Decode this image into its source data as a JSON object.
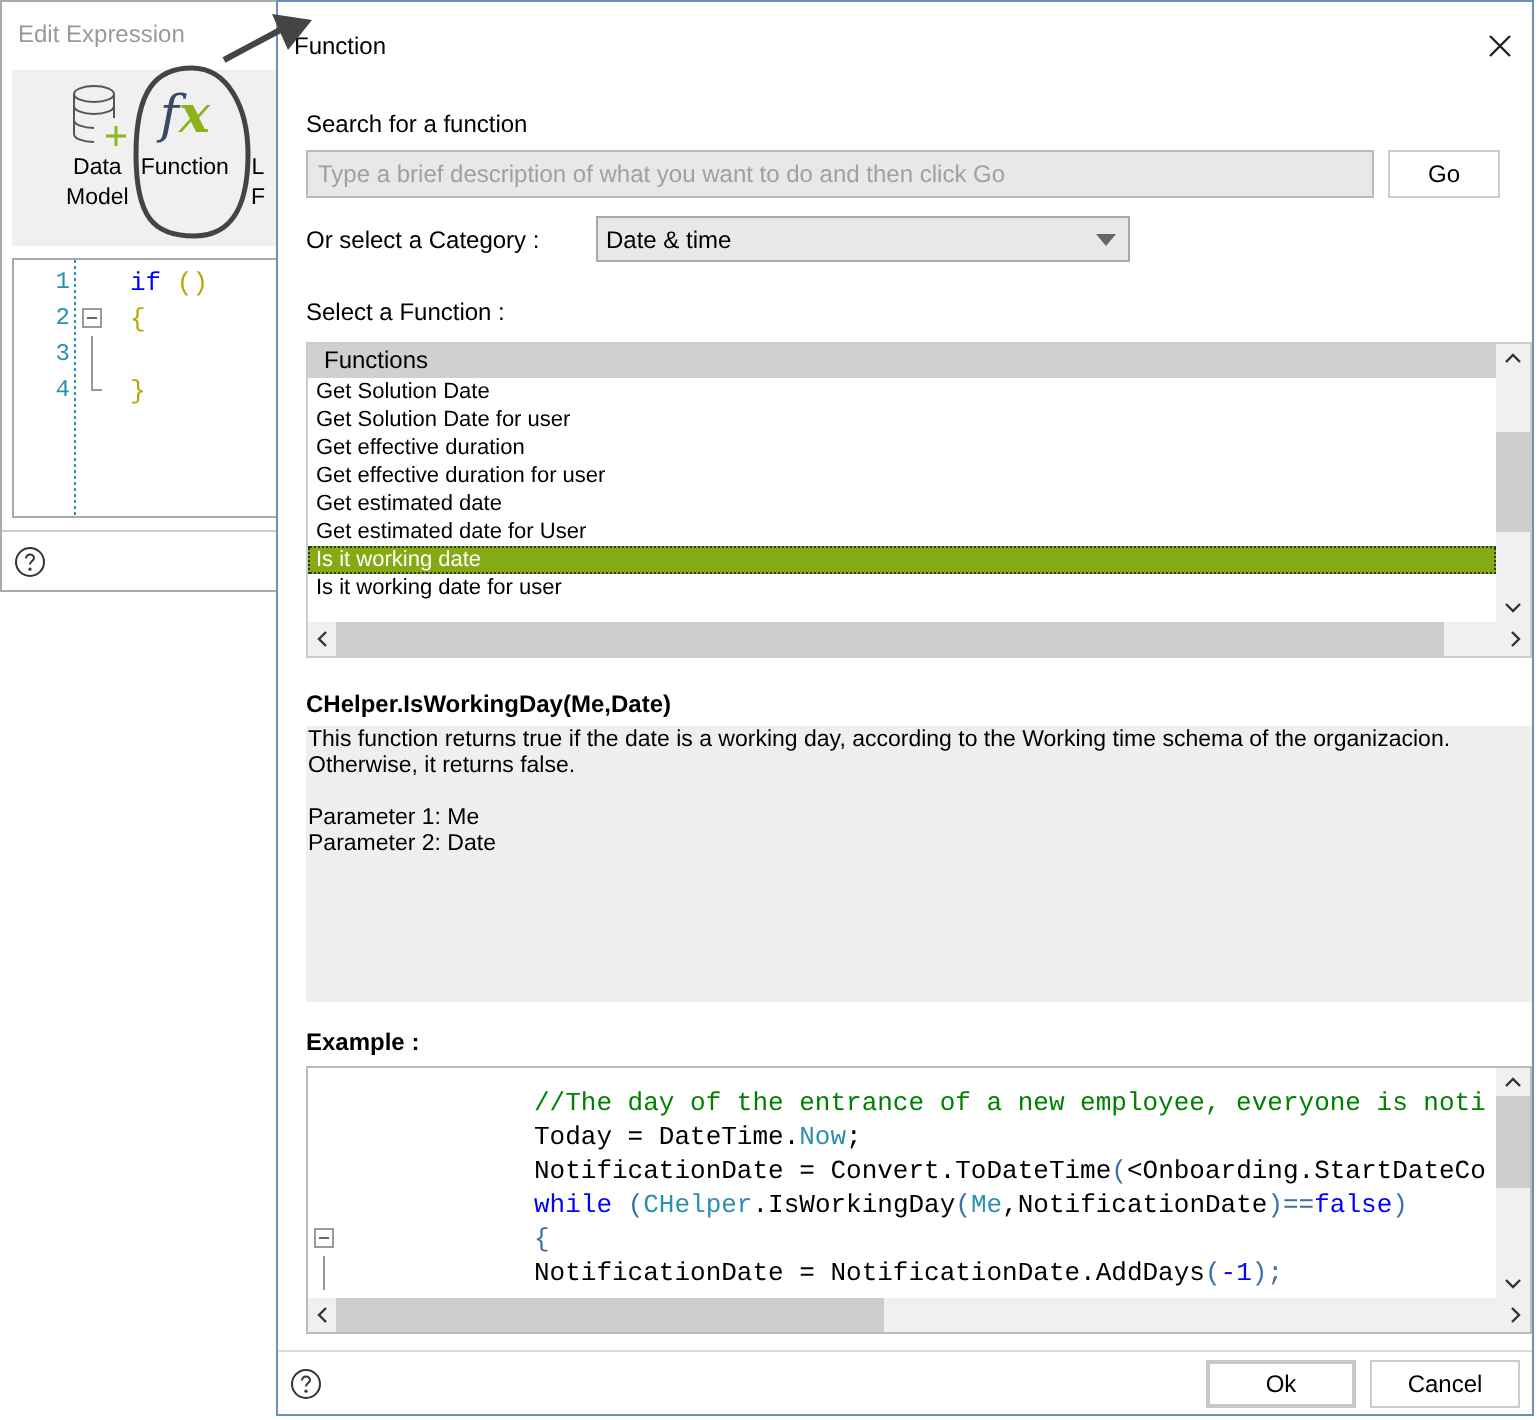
{
  "background_window": {
    "title": "Edit Expression",
    "toolbar": [
      {
        "kind": "database",
        "lines": [
          "Data",
          "Model"
        ]
      },
      {
        "kind": "fx",
        "glyph": "fx",
        "lines": [
          "Function"
        ]
      },
      {
        "kind": "cut",
        "lines": [
          "L",
          "F"
        ]
      }
    ],
    "editor": {
      "lines": [
        {
          "number": "1",
          "tokens": [
            {
              "kind": "keyword",
              "text": "if"
            },
            {
              "kind": "bracket",
              "text": " ()"
            }
          ]
        },
        {
          "number": "2",
          "kind": "fold_start",
          "tokens": [
            {
              "kind": "bracket",
              "text": "{"
            }
          ]
        },
        {
          "number": "3",
          "kind": "fold_line"
        },
        {
          "number": "4",
          "kind": "fold_end",
          "tokens": [
            {
              "kind": "bracket",
              "text": "}"
            }
          ]
        }
      ]
    }
  },
  "dialog": {
    "title": "Function",
    "search_label": "Search for a function",
    "search": {
      "placeholder": "Type a brief description of what you want to do and then click Go"
    },
    "go_button": "Go",
    "category_label": "Or select a Category :",
    "category": {
      "value": "Date & time"
    },
    "function_label": "Select a Function :",
    "function_list": {
      "header": "Functions",
      "items": [
        {
          "label": "Get Solution Date",
          "selected": false
        },
        {
          "label": "Get Solution Date for user",
          "selected": false
        },
        {
          "label": "Get effective duration",
          "selected": false
        },
        {
          "label": "Get effective duration for user",
          "selected": false
        },
        {
          "label": "Get estimated date",
          "selected": false
        },
        {
          "label": "Get estimated date for User",
          "selected": false
        },
        {
          "label": "Is it working date",
          "selected": true
        },
        {
          "label": "Is it working date for user",
          "selected": false
        }
      ]
    },
    "signature": "CHelper.IsWorkingDay(Me,Date)",
    "description": [
      [
        "This function returns true if the date is a working day, according to the Working time schema of the organizacion.",
        "Otherwise, it returns false."
      ],
      [
        "Parameter 1: Me",
        "Parameter 2: Date"
      ]
    ],
    "example_label": "Example :",
    "example": {
      "lines": [
        {
          "tokens": [
            {
              "kind": "comment",
              "text": "//The day of the entrance of a new employee, everyone is noti"
            }
          ]
        },
        {
          "tokens": [
            {
              "kind": "plain",
              "text": "Today = DateTime."
            },
            {
              "kind": "type",
              "text": "Now"
            },
            {
              "kind": "plain",
              "text": ";"
            }
          ]
        },
        {
          "tokens": [
            {
              "kind": "plain",
              "text": "NotificationDate = Convert.ToDateTime"
            },
            {
              "kind": "operator",
              "text": "("
            },
            {
              "kind": "plain",
              "text": "<Onboarding.StartDateCo"
            }
          ]
        },
        {
          "tokens": [
            {
              "kind": "keyword",
              "text": "while"
            },
            {
              "kind": "operator",
              "text": " ("
            },
            {
              "kind": "type",
              "text": "CHelper"
            },
            {
              "kind": "plain",
              "text": ".IsWorkingDay"
            },
            {
              "kind": "operator",
              "text": "("
            },
            {
              "kind": "type",
              "text": "Me"
            },
            {
              "kind": "plain",
              "text": ",NotificationDate"
            },
            {
              "kind": "operator",
              "text": ")=="
            },
            {
              "kind": "keyword",
              "text": "false"
            },
            {
              "kind": "operator",
              "text": ")"
            }
          ]
        },
        {
          "kind": "fold_start",
          "tokens": [
            {
              "kind": "operator",
              "text": "{"
            }
          ]
        },
        {
          "kind": "fold_line",
          "tokens": [
            {
              "kind": "plain",
              "text": "NotificationDate = NotificationDate.AddDays"
            },
            {
              "kind": "operator",
              "text": "("
            },
            {
              "kind": "number",
              "text": "-1"
            },
            {
              "kind": "operator",
              "text": ");"
            }
          ]
        }
      ]
    },
    "buttons": [
      {
        "label": "Ok",
        "default": true
      },
      {
        "label": "Cancel",
        "default": false
      }
    ]
  }
}
